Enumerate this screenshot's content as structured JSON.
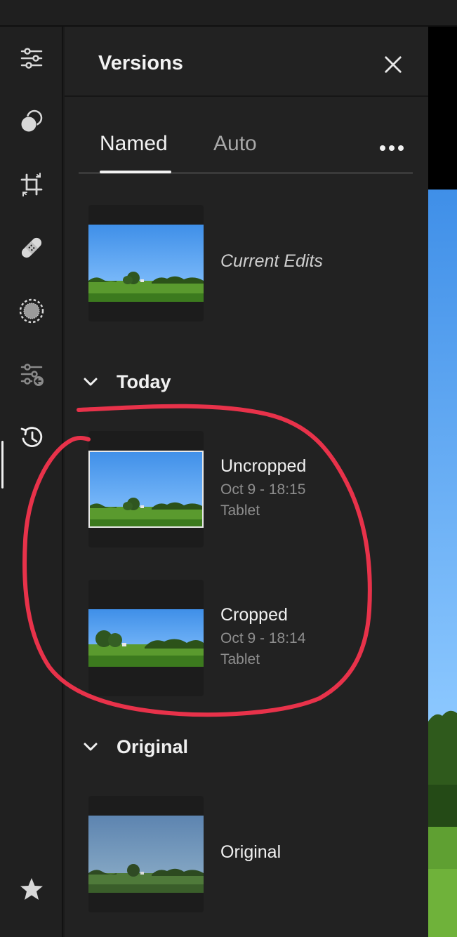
{
  "panel": {
    "title": "Versions",
    "close_icon": "close-icon",
    "more_icon": "more-horizontal-icon"
  },
  "tabs": [
    {
      "label": "Named",
      "active": true
    },
    {
      "label": "Auto",
      "active": false
    }
  ],
  "current": {
    "name": "Current Edits"
  },
  "sections": [
    {
      "label": "Today",
      "expanded": true,
      "versions": [
        {
          "name": "Uncropped",
          "date": "Oct 9 - 18:15",
          "device": "Tablet",
          "selected": true
        },
        {
          "name": "Cropped",
          "date": "Oct 9 - 18:14",
          "device": "Tablet",
          "selected": false
        }
      ]
    },
    {
      "label": "Original",
      "expanded": true,
      "versions": [
        {
          "name": "Original"
        }
      ]
    }
  ],
  "toolrail": [
    {
      "icon": "sliders-icon",
      "active": false
    },
    {
      "icon": "presets-icon",
      "active": false
    },
    {
      "icon": "crop-icon",
      "active": false
    },
    {
      "icon": "healing-bandage-icon",
      "active": false
    },
    {
      "icon": "masking-icon",
      "active": false
    },
    {
      "icon": "remove-adjustments-icon",
      "active": false
    },
    {
      "icon": "versions-history-icon",
      "active": true
    },
    {
      "icon": "star-icon",
      "active": false
    }
  ],
  "colors": {
    "panel_bg": "#222222",
    "rail_bg": "#202020",
    "annotation": "#e8324a",
    "text_primary": "#f0f0f0",
    "text_secondary": "#8e8e8e"
  }
}
